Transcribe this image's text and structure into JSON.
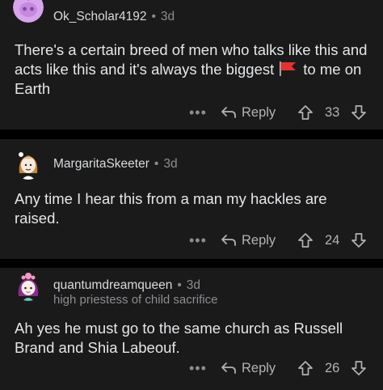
{
  "comments": [
    {
      "username": "Ok_Scholar4192",
      "separator": "•",
      "time": "3d",
      "flair": "",
      "text_before_flag": "There's a certain breed of men who talks like this and acts like this and it's always the biggest",
      "flag_icon": "red-flag-icon",
      "text_after_flag": "to me on Earth",
      "reply_label": "Reply",
      "more_label": "•••",
      "score": "33"
    },
    {
      "username": "MargaritaSkeeter",
      "separator": "•",
      "time": "3d",
      "flair": "",
      "text": "Any time I hear this from a man my hackles are raised.",
      "reply_label": "Reply",
      "more_label": "•••",
      "score": "24"
    },
    {
      "username": "quantumdreamqueen",
      "separator": "•",
      "time": "3d",
      "flair": "high priestess of child sacrifice",
      "text": "Ah yes he must go to the same church as Russell Brand and Shia Labeouf.",
      "reply_label": "Reply",
      "more_label": "•••",
      "score": "26"
    }
  ],
  "colors": {
    "background": "#000000",
    "card": "#1a1a1b",
    "text": "#e4e6e8",
    "meta": "#8b8d90",
    "flag": "#e5322d"
  }
}
